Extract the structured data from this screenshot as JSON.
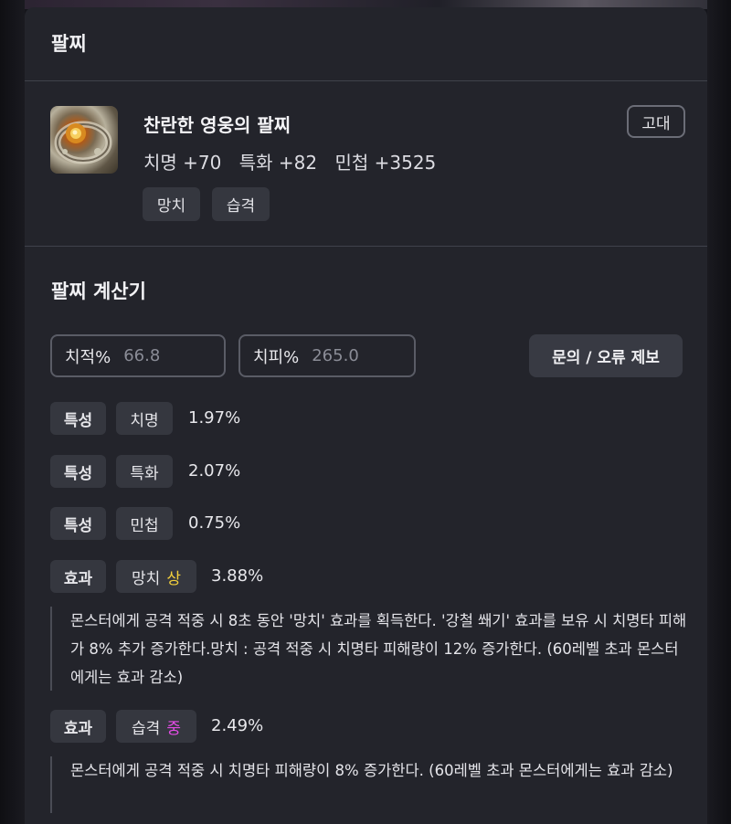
{
  "bracelet": {
    "section_title": "팔찌",
    "item": {
      "name": "찬란한 영웅의 팔찌",
      "grade": "고대",
      "stats": [
        "치명 +70",
        "특화 +82",
        "민첩 +3525"
      ],
      "tags": [
        "망치",
        "습격"
      ],
      "icon": "bracelet-icon"
    }
  },
  "calculator": {
    "section_title": "팔찌 계산기",
    "crit_rate": {
      "label": "치적%",
      "placeholder": "66.8"
    },
    "crit_damage": {
      "label": "치피%",
      "placeholder": "265.0"
    },
    "report_button": "문의 / 오류 제보",
    "rows": [
      {
        "kind": "특성",
        "name": "치명",
        "grade": "",
        "value": "1.97%"
      },
      {
        "kind": "특성",
        "name": "특화",
        "grade": "",
        "value": "2.07%"
      },
      {
        "kind": "특성",
        "name": "민첩",
        "grade": "",
        "value": "0.75%"
      },
      {
        "kind": "효과",
        "name": "망치",
        "grade": "상",
        "value": "3.88%",
        "description": "몬스터에게 공격 적중 시 8초 동안 '망치' 효과를 획득한다. '강철 쐐기' 효과를 보유 시 치명타 피해가 8% 추가 증가한다.망치 : 공격 적중 시 치명타 피해량이 12% 증가한다. (60레벨 초과 몬스터에게는 효과 감소)"
      },
      {
        "kind": "효과",
        "name": "습격",
        "grade": "중",
        "value": "2.49%",
        "description": "몬스터에게 공격 적중 시 치명타 피해량이 8% 증가한다. (60레벨 초과 몬스터에게는 효과 감소)"
      }
    ]
  },
  "colors": {
    "background": "#15151b",
    "panel": "#23242b",
    "chip": "#35373f",
    "grade_high": "#f2cf3c",
    "grade_mid": "#e44ce6"
  }
}
